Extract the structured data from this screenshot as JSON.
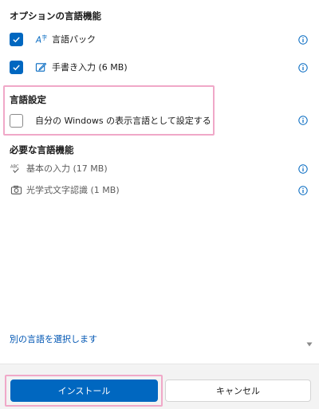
{
  "optional_features": {
    "title": "オプションの言語機能",
    "items": [
      {
        "label": "言語パック",
        "checked": true,
        "icon": "language-pack-icon"
      },
      {
        "label": "手書き入力 (6 MB)",
        "checked": true,
        "icon": "handwriting-icon"
      }
    ]
  },
  "language_settings": {
    "title": "言語設定",
    "items": [
      {
        "label": "自分の Windows の表示言語として設定する",
        "checked": false
      }
    ]
  },
  "required_features": {
    "title": "必要な言語機能",
    "items": [
      {
        "label": "基本の入力 (17 MB)",
        "icon": "basic-typing-icon"
      },
      {
        "label": "光学式文字認識 (1 MB)",
        "icon": "ocr-icon"
      }
    ]
  },
  "choose_another_link": "別の言語を選択します",
  "buttons": {
    "install": "インストール",
    "cancel": "キャンセル"
  },
  "colors": {
    "accent": "#0067c0",
    "highlight": "#f0a8c8"
  }
}
